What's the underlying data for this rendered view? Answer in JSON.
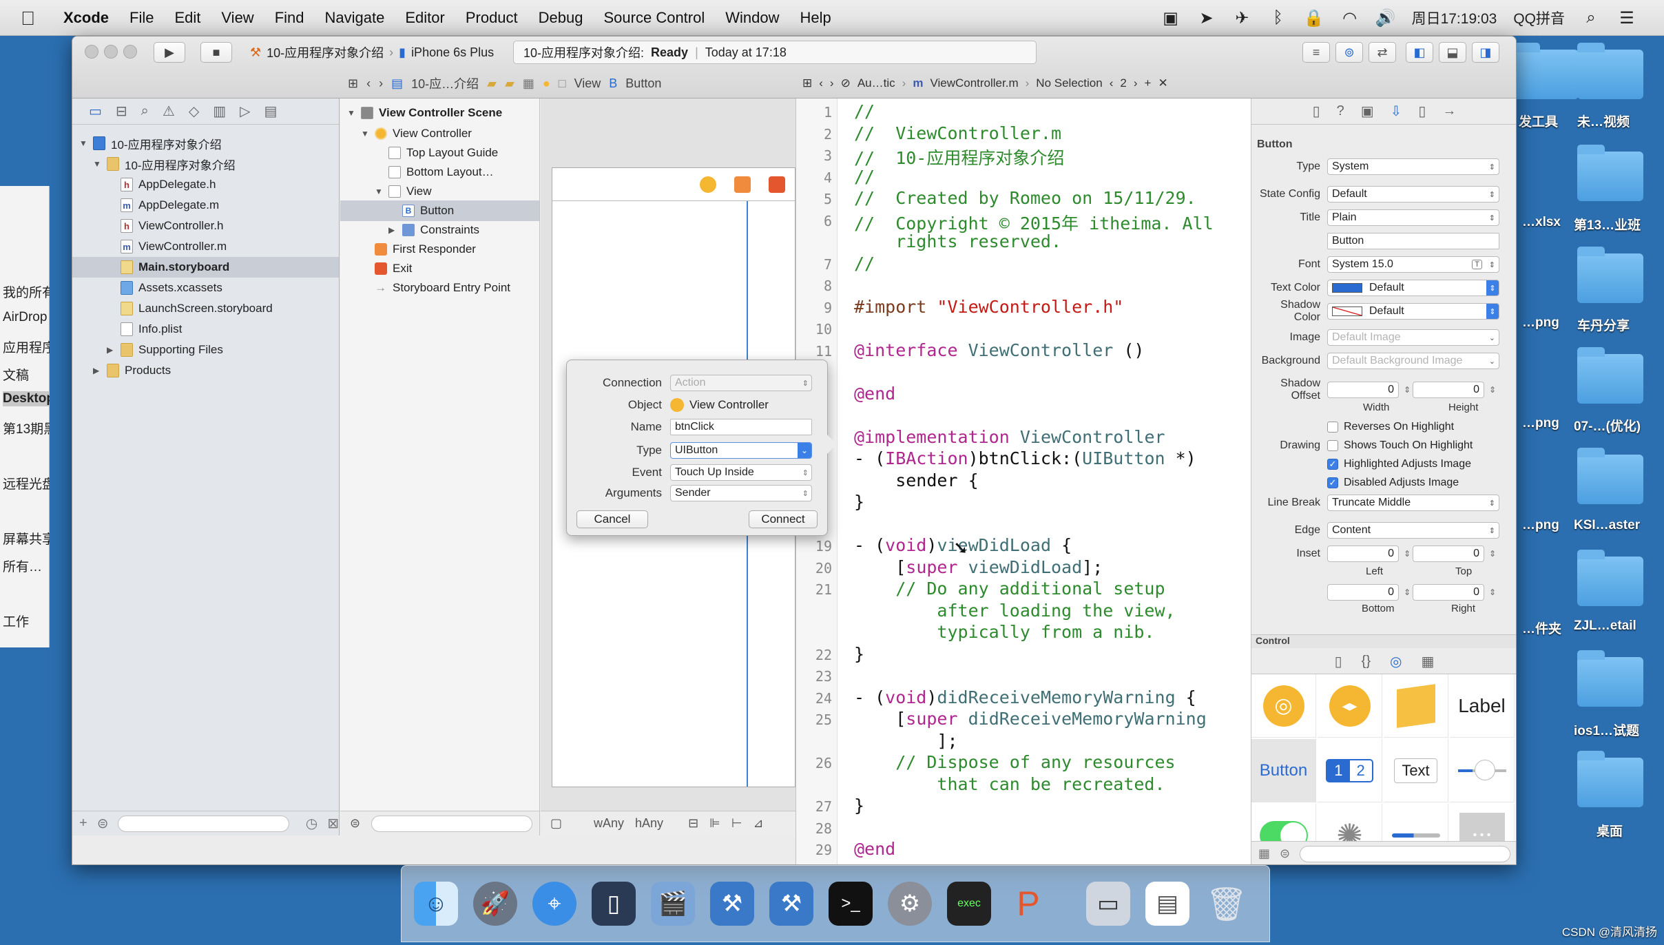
{
  "menubar": {
    "app": "Xcode",
    "items": [
      "File",
      "Edit",
      "View",
      "Find",
      "Navigate",
      "Editor",
      "Product",
      "Debug",
      "Source Control",
      "Window",
      "Help"
    ],
    "clock": "周日17:19:03",
    "input_method": "QQ拼音"
  },
  "desktop": {
    "icons": [
      "发工具",
      "未…视频",
      "…xlsx",
      "第13…业班",
      "…png",
      "车丹分享",
      "…png",
      "07-…(优化)",
      "…png",
      "KSI…aster",
      "…件夹",
      "ZJL…etail",
      "ios1…试题",
      "桌面"
    ]
  },
  "finder_sidebar": {
    "items": [
      "我的所有",
      "AirDrop",
      "应用程序",
      "文稿",
      "Desktop",
      "第13期黑",
      "远程光盘",
      "屏幕共享",
      "所有…",
      "工作"
    ]
  },
  "toolbar": {
    "scheme_target": "10-应用程序对象介绍",
    "device": "iPhone 6s Plus",
    "status_project": "10-应用程序对象介绍:",
    "status_state": "Ready",
    "status_time": "Today at 17:18"
  },
  "ib_jumpbar": {
    "crumbs": [
      "10-应…介绍",
      "View",
      "Button"
    ]
  },
  "editor_jumpbar": {
    "mode": "Au…tic",
    "file": "ViewController.m",
    "selection": "No Selection",
    "count": "2"
  },
  "navigator": {
    "items": [
      {
        "label": "10-应用程序对象介绍",
        "icon": "project-icon",
        "depth": 0,
        "open": true
      },
      {
        "label": "10-应用程序对象介绍",
        "icon": "folder-icon",
        "depth": 1,
        "open": true
      },
      {
        "label": "AppDelegate.h",
        "icon": "h",
        "depth": 2
      },
      {
        "label": "AppDelegate.m",
        "icon": "m",
        "depth": 2
      },
      {
        "label": "ViewController.h",
        "icon": "h",
        "depth": 2
      },
      {
        "label": "ViewController.m",
        "icon": "m",
        "depth": 2
      },
      {
        "label": "Main.storyboard",
        "icon": "storyboard-icon",
        "depth": 2,
        "selected": true
      },
      {
        "label": "Assets.xcassets",
        "icon": "assets-icon",
        "depth": 2
      },
      {
        "label": "LaunchScreen.storyboard",
        "icon": "storyboard-icon",
        "depth": 2
      },
      {
        "label": "Info.plist",
        "icon": "plist-icon",
        "depth": 2
      },
      {
        "label": "Supporting Files",
        "icon": "folder-icon",
        "depth": 2,
        "closed": true
      },
      {
        "label": "Products",
        "icon": "folder-icon",
        "depth": 1,
        "closed": true
      }
    ]
  },
  "outline": {
    "items": [
      {
        "label": "View Controller Scene",
        "bold": true,
        "depth": 0
      },
      {
        "label": "View Controller",
        "depth": 1
      },
      {
        "label": "Top Layout Guide",
        "depth": 2
      },
      {
        "label": "Bottom Layout…",
        "depth": 2
      },
      {
        "label": "View",
        "depth": 2
      },
      {
        "label": "Button",
        "depth": 3,
        "selected": true
      },
      {
        "label": "Constraints",
        "depth": 3
      },
      {
        "label": "First Responder",
        "depth": 1
      },
      {
        "label": "Exit",
        "depth": 1
      },
      {
        "label": "Storyboard Entry Point",
        "depth": 1
      }
    ]
  },
  "canvas": {
    "size_class_w": "wAny",
    "size_class_h": "hAny"
  },
  "connection_popover": {
    "connection_label": "Connection",
    "connection_value": "Action",
    "object_label": "Object",
    "object_value": "View Controller",
    "name_label": "Name",
    "name_value": "btnClick",
    "type_label": "Type",
    "type_value": "UIButton",
    "event_label": "Event",
    "event_value": "Touch Up Inside",
    "arguments_label": "Arguments",
    "arguments_value": "Sender",
    "cancel": "Cancel",
    "connect": "Connect"
  },
  "code": {
    "lines": [
      {
        "n": "1",
        "t": "//"
      },
      {
        "n": "2",
        "t": "//  ViewController.m"
      },
      {
        "n": "3",
        "t": "//  10-应用程序对象介绍"
      },
      {
        "n": "4",
        "t": "//"
      },
      {
        "n": "5",
        "t": "//  Created by Romeo on 15/11/29."
      },
      {
        "n": "6",
        "t": "//  Copyright © 2015年 itheima. All"
      },
      {
        "n": "",
        "t": "    rights reserved."
      },
      {
        "n": "7",
        "t": "//"
      },
      {
        "n": "8",
        "t": ""
      },
      {
        "n": "9",
        "t": "#import \"ViewController.h\""
      },
      {
        "n": "10",
        "t": ""
      },
      {
        "n": "11",
        "t": "@interface ViewController ()"
      },
      {
        "n": "",
        "t": ""
      },
      {
        "n": "",
        "t": "@end"
      },
      {
        "n": "",
        "t": ""
      },
      {
        "n": "",
        "t": "@implementation ViewController"
      },
      {
        "n": "",
        "t": "- (IBAction)btnClick:(UIButton *)"
      },
      {
        "n": "",
        "t": "    sender {"
      },
      {
        "n": "",
        "t": "}"
      },
      {
        "n": "",
        "t": ""
      },
      {
        "n": "19",
        "t": "- (void)viewDidLoad {"
      },
      {
        "n": "20",
        "t": "    [super viewDidLoad];"
      },
      {
        "n": "21",
        "t": "    // Do any additional setup"
      },
      {
        "n": "",
        "t": "        after loading the view,"
      },
      {
        "n": "",
        "t": "        typically from a nib."
      },
      {
        "n": "22",
        "t": "}"
      },
      {
        "n": "23",
        "t": ""
      },
      {
        "n": "24",
        "t": "- (void)didReceiveMemoryWarning {"
      },
      {
        "n": "25",
        "t": "    [super didReceiveMemoryWarning"
      },
      {
        "n": "",
        "t": "        ];"
      },
      {
        "n": "26",
        "t": "    // Dispose of any resources"
      },
      {
        "n": "",
        "t": "        that can be recreated."
      },
      {
        "n": "27",
        "t": "}"
      },
      {
        "n": "28",
        "t": ""
      },
      {
        "n": "29",
        "t": "@end"
      }
    ]
  },
  "inspector": {
    "section": "Button",
    "type_label": "Type",
    "type_value": "System",
    "state_label": "State Config",
    "state_value": "Default",
    "title_label": "Title",
    "title_value": "Plain",
    "title_text": "Button",
    "font_label": "Font",
    "font_value": "System 15.0",
    "text_color_label": "Text Color",
    "text_color_value": "Default",
    "text_color_swatch": "#2a6bd1",
    "shadow_color_label": "Shadow Color",
    "shadow_color_value": "Default",
    "shadow_color_swatch": "#ffffff",
    "image_label": "Image",
    "image_value": "Default Image",
    "background_label": "Background",
    "background_value": "Default Background Image",
    "shadow_offset_label": "Shadow Offset",
    "shadow_w": "0",
    "shadow_h": "0",
    "width_label": "Width",
    "height_label": "Height",
    "drawing_label": "Drawing",
    "reverses": "Reverses On Highlight",
    "shows_touch": "Shows Touch On Highlight",
    "highlighted_adjusts": "Highlighted Adjusts Image",
    "disabled_adjusts": "Disabled Adjusts Image",
    "line_break_label": "Line Break",
    "line_break_value": "Truncate Middle",
    "edge_label": "Edge",
    "edge_value": "Content",
    "inset_label": "Inset",
    "inset_left": "0",
    "inset_top": "0",
    "inset_bottom": "0",
    "inset_right": "0",
    "left_label": "Left",
    "top_label": "Top",
    "bottom_label": "Bottom",
    "right_label": "Right",
    "control_label": "Control"
  },
  "library": {
    "label_text": "Label",
    "button_text": "Button",
    "seg1": "1",
    "seg2": "2",
    "text_text": "Text"
  },
  "watermark": "CSDN @清风清扬"
}
